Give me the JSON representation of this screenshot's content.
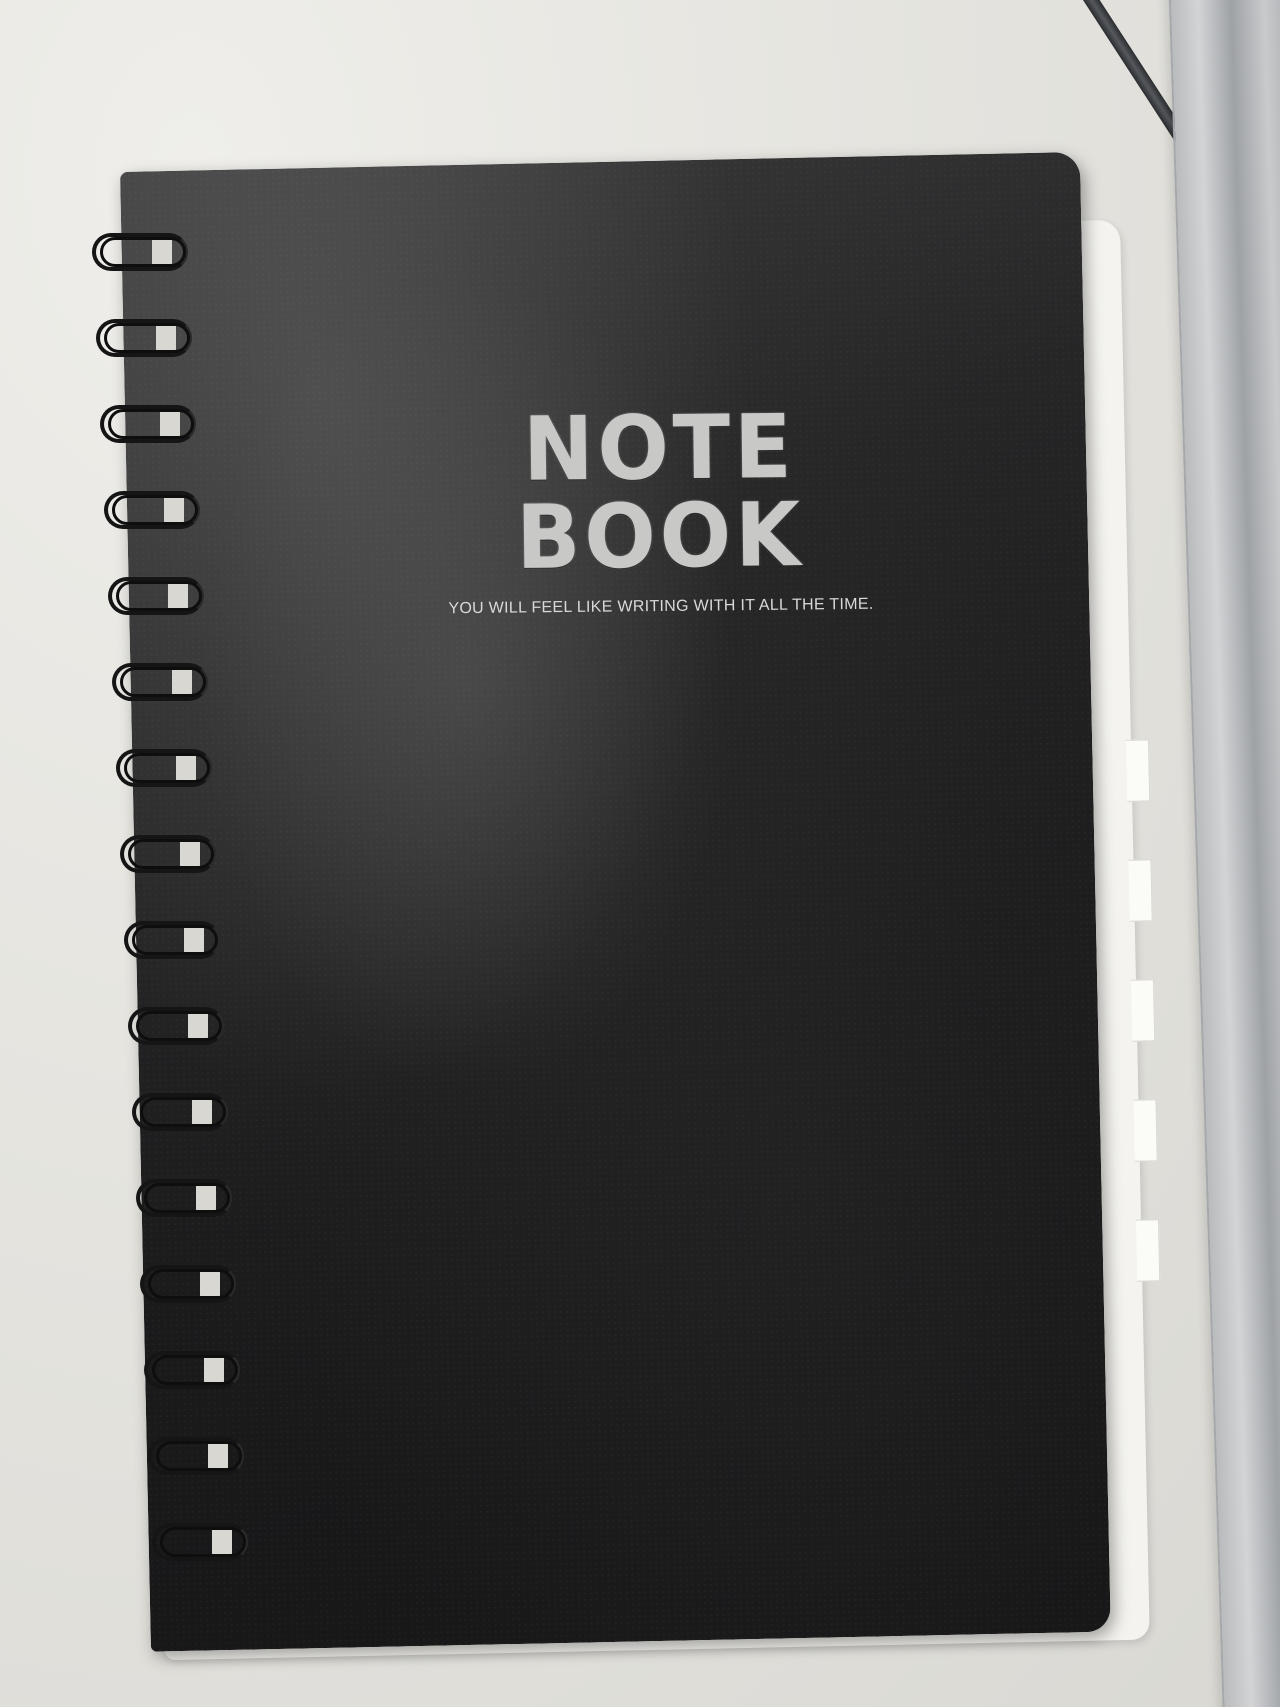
{
  "notebook": {
    "title": "NOTE BOOK",
    "tagline": "YOU WILL FEEL LIKE WRITING WITH IT ALL THE TIME.",
    "cover_color": "#1f1f20",
    "text_color": "#c8c8c6",
    "ring_count": 16
  }
}
